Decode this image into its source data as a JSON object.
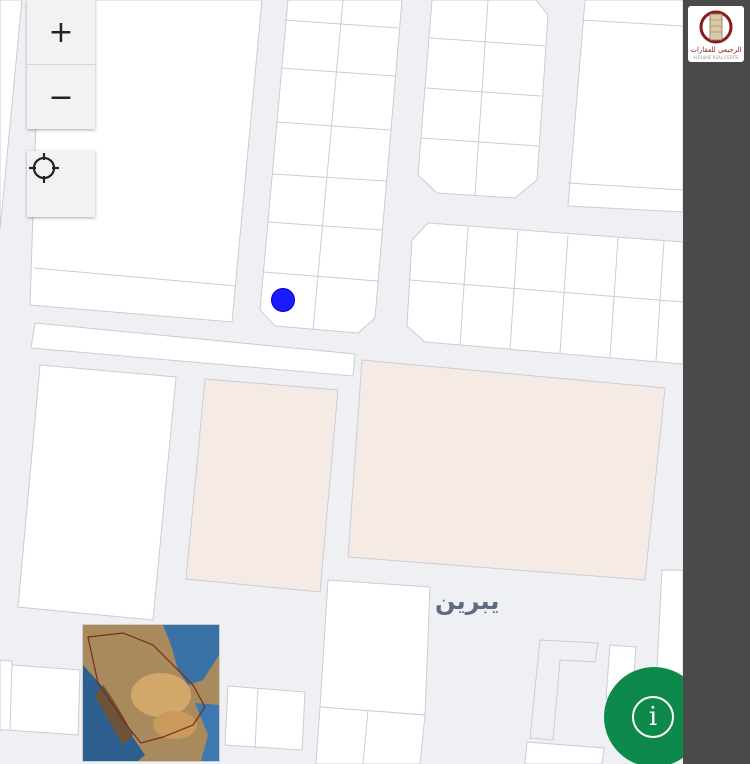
{
  "map": {
    "place_label": "يبرين",
    "land_color": "#eef0f4",
    "parcel_color": "#ffffff",
    "highlight_parcel_color": "#f5ebe4",
    "parcel_stroke": "#c9cdd6"
  },
  "controls": {
    "zoom_in_label": "+",
    "zoom_out_label": "−",
    "locate_icon": "crosshair-icon"
  },
  "user_location": {
    "color": "#1a1aff"
  },
  "minimap": {
    "subject": "Saudi Arabia satellite overview"
  },
  "info_button": {
    "label": "i",
    "color": "#0d8a4b"
  },
  "logo": {
    "text": "الرجيعي للعقارات",
    "subtext": "ALRUJAIE REAL ESTATE"
  }
}
